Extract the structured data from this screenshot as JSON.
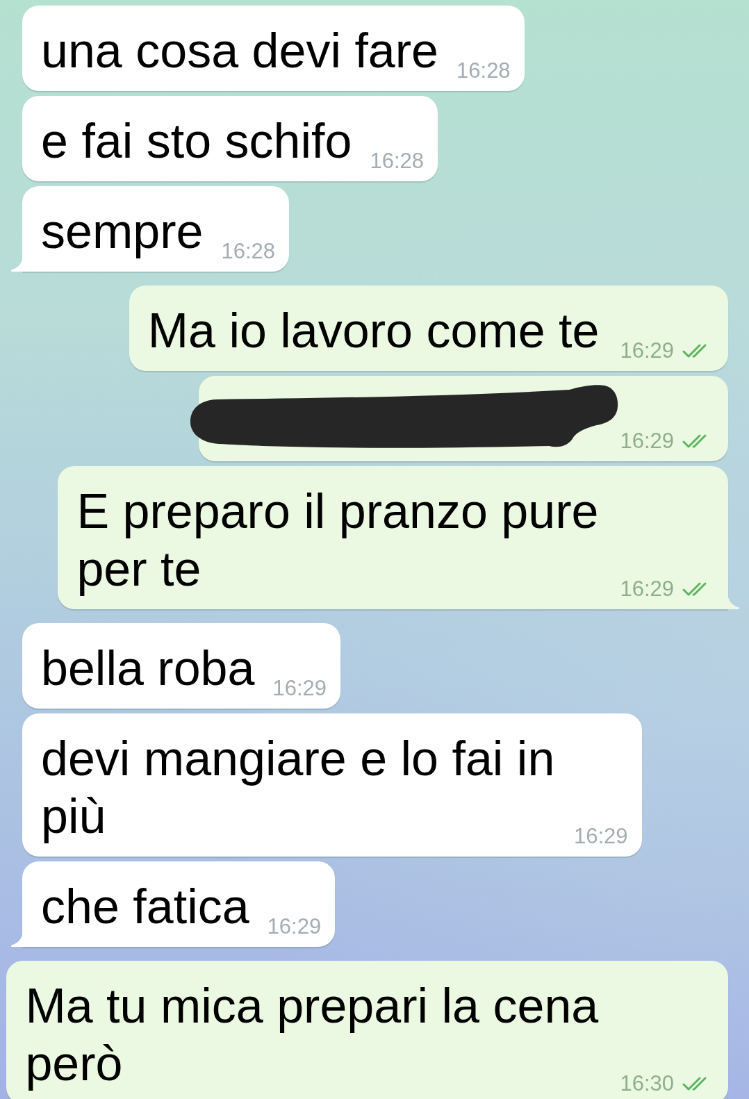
{
  "messages": [
    {
      "outgoing": false,
      "kind": "text",
      "text": "una cosa devi fare",
      "time": "16:28"
    },
    {
      "outgoing": false,
      "kind": "text",
      "text": "e fai sto schifo",
      "time": "16:28"
    },
    {
      "outgoing": false,
      "kind": "text",
      "text": "sempre",
      "time": "16:28"
    },
    {
      "outgoing": true,
      "kind": "text",
      "text": "Ma io lavoro come te",
      "time": "16:29",
      "read": true
    },
    {
      "outgoing": true,
      "kind": "redacted",
      "time": "16:29",
      "read": true
    },
    {
      "outgoing": true,
      "kind": "text",
      "text": "E preparo il pranzo pure per te",
      "time": "16:29",
      "read": true
    },
    {
      "outgoing": false,
      "kind": "text",
      "text": "bella roba",
      "time": "16:29"
    },
    {
      "outgoing": false,
      "kind": "text",
      "text": "devi mangiare e lo fai in più",
      "time": "16:29"
    },
    {
      "outgoing": false,
      "kind": "text",
      "text": "che fatica",
      "time": "16:29"
    },
    {
      "outgoing": true,
      "kind": "text",
      "text": "Ma tu mica prepari la cena però",
      "time": "16:30",
      "read": true
    }
  ]
}
